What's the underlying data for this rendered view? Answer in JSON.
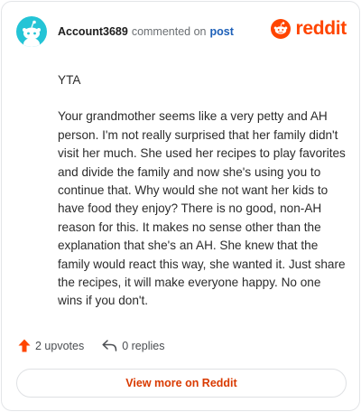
{
  "header": {
    "username": "Account3689",
    "action_text": "commented on",
    "target_link": "post",
    "brand": "reddit"
  },
  "comment": {
    "paragraphs": [
      "YTA",
      "Your grandmother seems like a very petty and AH person. I'm not really surprised that her family didn't visit her much. She used her recipes to play favorites and divide the family and now she's using you to continue that. Why would she not want her kids to have food they enjoy? There is no good, non-AH reason for this. It makes no sense other than the explanation that she's an AH. She knew that the family would react this way, she wanted it. Just share the recipes, it will make everyone happy. No one wins if you don't."
    ]
  },
  "footer": {
    "upvotes": "2 upvotes",
    "replies": "0 replies"
  },
  "cta": {
    "label": "View more on Reddit"
  },
  "colors": {
    "brand": "#ff4500",
    "avatar": "#24c4d6",
    "link": "#1c5fb8",
    "cta_text": "#d93a00"
  }
}
